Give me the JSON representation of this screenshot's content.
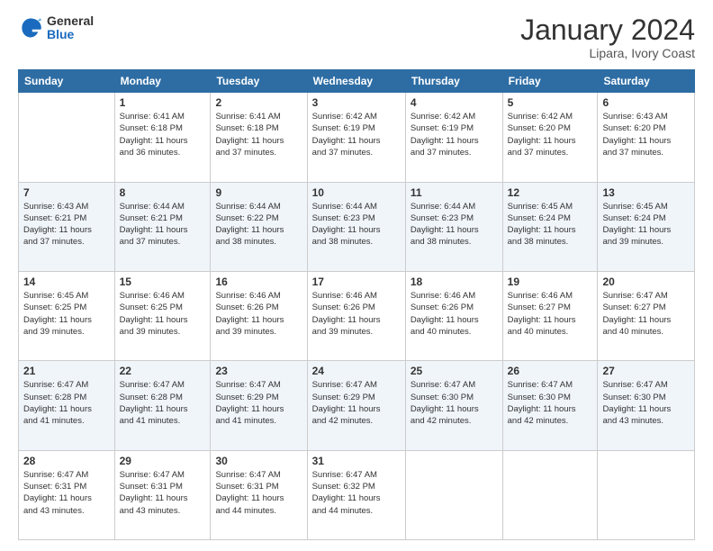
{
  "logo": {
    "general": "General",
    "blue": "Blue"
  },
  "header": {
    "title": "January 2024",
    "subtitle": "Lipara, Ivory Coast"
  },
  "weekdays": [
    "Sunday",
    "Monday",
    "Tuesday",
    "Wednesday",
    "Thursday",
    "Friday",
    "Saturday"
  ],
  "weeks": [
    [
      {
        "day": "",
        "info": ""
      },
      {
        "day": "1",
        "info": "Sunrise: 6:41 AM\nSunset: 6:18 PM\nDaylight: 11 hours\nand 36 minutes."
      },
      {
        "day": "2",
        "info": "Sunrise: 6:41 AM\nSunset: 6:18 PM\nDaylight: 11 hours\nand 37 minutes."
      },
      {
        "day": "3",
        "info": "Sunrise: 6:42 AM\nSunset: 6:19 PM\nDaylight: 11 hours\nand 37 minutes."
      },
      {
        "day": "4",
        "info": "Sunrise: 6:42 AM\nSunset: 6:19 PM\nDaylight: 11 hours\nand 37 minutes."
      },
      {
        "day": "5",
        "info": "Sunrise: 6:42 AM\nSunset: 6:20 PM\nDaylight: 11 hours\nand 37 minutes."
      },
      {
        "day": "6",
        "info": "Sunrise: 6:43 AM\nSunset: 6:20 PM\nDaylight: 11 hours\nand 37 minutes."
      }
    ],
    [
      {
        "day": "7",
        "info": "Sunrise: 6:43 AM\nSunset: 6:21 PM\nDaylight: 11 hours\nand 37 minutes."
      },
      {
        "day": "8",
        "info": "Sunrise: 6:44 AM\nSunset: 6:21 PM\nDaylight: 11 hours\nand 37 minutes."
      },
      {
        "day": "9",
        "info": "Sunrise: 6:44 AM\nSunset: 6:22 PM\nDaylight: 11 hours\nand 38 minutes."
      },
      {
        "day": "10",
        "info": "Sunrise: 6:44 AM\nSunset: 6:23 PM\nDaylight: 11 hours\nand 38 minutes."
      },
      {
        "day": "11",
        "info": "Sunrise: 6:44 AM\nSunset: 6:23 PM\nDaylight: 11 hours\nand 38 minutes."
      },
      {
        "day": "12",
        "info": "Sunrise: 6:45 AM\nSunset: 6:24 PM\nDaylight: 11 hours\nand 38 minutes."
      },
      {
        "day": "13",
        "info": "Sunrise: 6:45 AM\nSunset: 6:24 PM\nDaylight: 11 hours\nand 39 minutes."
      }
    ],
    [
      {
        "day": "14",
        "info": "Sunrise: 6:45 AM\nSunset: 6:25 PM\nDaylight: 11 hours\nand 39 minutes."
      },
      {
        "day": "15",
        "info": "Sunrise: 6:46 AM\nSunset: 6:25 PM\nDaylight: 11 hours\nand 39 minutes."
      },
      {
        "day": "16",
        "info": "Sunrise: 6:46 AM\nSunset: 6:26 PM\nDaylight: 11 hours\nand 39 minutes."
      },
      {
        "day": "17",
        "info": "Sunrise: 6:46 AM\nSunset: 6:26 PM\nDaylight: 11 hours\nand 39 minutes."
      },
      {
        "day": "18",
        "info": "Sunrise: 6:46 AM\nSunset: 6:26 PM\nDaylight: 11 hours\nand 40 minutes."
      },
      {
        "day": "19",
        "info": "Sunrise: 6:46 AM\nSunset: 6:27 PM\nDaylight: 11 hours\nand 40 minutes."
      },
      {
        "day": "20",
        "info": "Sunrise: 6:47 AM\nSunset: 6:27 PM\nDaylight: 11 hours\nand 40 minutes."
      }
    ],
    [
      {
        "day": "21",
        "info": "Sunrise: 6:47 AM\nSunset: 6:28 PM\nDaylight: 11 hours\nand 41 minutes."
      },
      {
        "day": "22",
        "info": "Sunrise: 6:47 AM\nSunset: 6:28 PM\nDaylight: 11 hours\nand 41 minutes."
      },
      {
        "day": "23",
        "info": "Sunrise: 6:47 AM\nSunset: 6:29 PM\nDaylight: 11 hours\nand 41 minutes."
      },
      {
        "day": "24",
        "info": "Sunrise: 6:47 AM\nSunset: 6:29 PM\nDaylight: 11 hours\nand 42 minutes."
      },
      {
        "day": "25",
        "info": "Sunrise: 6:47 AM\nSunset: 6:30 PM\nDaylight: 11 hours\nand 42 minutes."
      },
      {
        "day": "26",
        "info": "Sunrise: 6:47 AM\nSunset: 6:30 PM\nDaylight: 11 hours\nand 42 minutes."
      },
      {
        "day": "27",
        "info": "Sunrise: 6:47 AM\nSunset: 6:30 PM\nDaylight: 11 hours\nand 43 minutes."
      }
    ],
    [
      {
        "day": "28",
        "info": "Sunrise: 6:47 AM\nSunset: 6:31 PM\nDaylight: 11 hours\nand 43 minutes."
      },
      {
        "day": "29",
        "info": "Sunrise: 6:47 AM\nSunset: 6:31 PM\nDaylight: 11 hours\nand 43 minutes."
      },
      {
        "day": "30",
        "info": "Sunrise: 6:47 AM\nSunset: 6:31 PM\nDaylight: 11 hours\nand 44 minutes."
      },
      {
        "day": "31",
        "info": "Sunrise: 6:47 AM\nSunset: 6:32 PM\nDaylight: 11 hours\nand 44 minutes."
      },
      {
        "day": "",
        "info": ""
      },
      {
        "day": "",
        "info": ""
      },
      {
        "day": "",
        "info": ""
      }
    ]
  ]
}
